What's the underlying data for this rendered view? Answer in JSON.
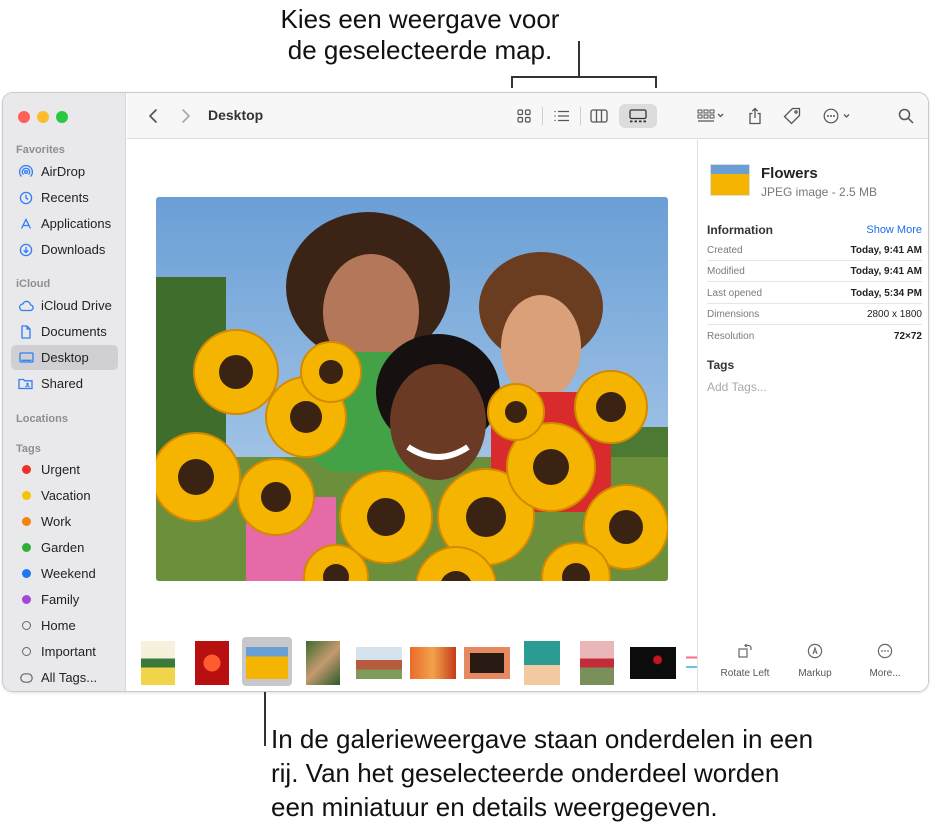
{
  "callouts": {
    "top_line1": "Kies een weergave voor",
    "top_line2": "de geselecteerde map.",
    "bottom_line1": "In de galerieweergave staan onderdelen in een",
    "bottom_line2": "rij. Van het geselecteerde onderdeel worden",
    "bottom_line3": "een miniatuur en details weergegeven."
  },
  "window": {
    "title": "Desktop"
  },
  "sidebar": {
    "favorites_label": "Favorites",
    "favorites": [
      {
        "label": "AirDrop",
        "icon": "airdrop-icon"
      },
      {
        "label": "Recents",
        "icon": "clock-icon"
      },
      {
        "label": "Applications",
        "icon": "applications-icon"
      },
      {
        "label": "Downloads",
        "icon": "download-icon"
      }
    ],
    "icloud_label": "iCloud",
    "icloud": [
      {
        "label": "iCloud Drive",
        "icon": "cloud-icon"
      },
      {
        "label": "Documents",
        "icon": "document-icon"
      },
      {
        "label": "Desktop",
        "icon": "desktop-icon",
        "selected": true
      },
      {
        "label": "Shared",
        "icon": "shared-folder-icon"
      }
    ],
    "locations_label": "Locations",
    "tags_label": "Tags",
    "tags": [
      {
        "label": "Urgent",
        "color": "#f0302a"
      },
      {
        "label": "Vacation",
        "color": "#f5c400"
      },
      {
        "label": "Work",
        "color": "#f5820a"
      },
      {
        "label": "Garden",
        "color": "#2bb03a"
      },
      {
        "label": "Weekend",
        "color": "#1f77f0"
      },
      {
        "label": "Family",
        "color": "#a446d8"
      },
      {
        "label": "Home",
        "color": ""
      },
      {
        "label": "Important",
        "color": ""
      },
      {
        "label": "All Tags...",
        "color": ""
      }
    ]
  },
  "inspector": {
    "file_name": "Flowers",
    "file_meta": "JPEG image - 2.5 MB",
    "information_label": "Information",
    "show_more": "Show More",
    "rows": [
      {
        "key": "Created",
        "value": "Today, 9:41 AM"
      },
      {
        "key": "Modified",
        "value": "Today, 9:41 AM"
      },
      {
        "key": "Last opened",
        "value": "Today, 5:34 PM"
      },
      {
        "key": "Dimensions",
        "value": "2800 x 1800"
      },
      {
        "key": "Resolution",
        "value": "72×72"
      }
    ],
    "tags_label": "Tags",
    "tags_placeholder": "Add Tags...",
    "actions": [
      {
        "label": "Rotate Left",
        "icon": "rotate-left-icon"
      },
      {
        "label": "Markup",
        "icon": "markup-icon"
      },
      {
        "label": "More...",
        "icon": "more-icon"
      }
    ]
  },
  "colors": {
    "accent": "#1c6ef0",
    "sidebar_bg": "#e9e9eb",
    "selected_bg": "#d0d0d4"
  }
}
